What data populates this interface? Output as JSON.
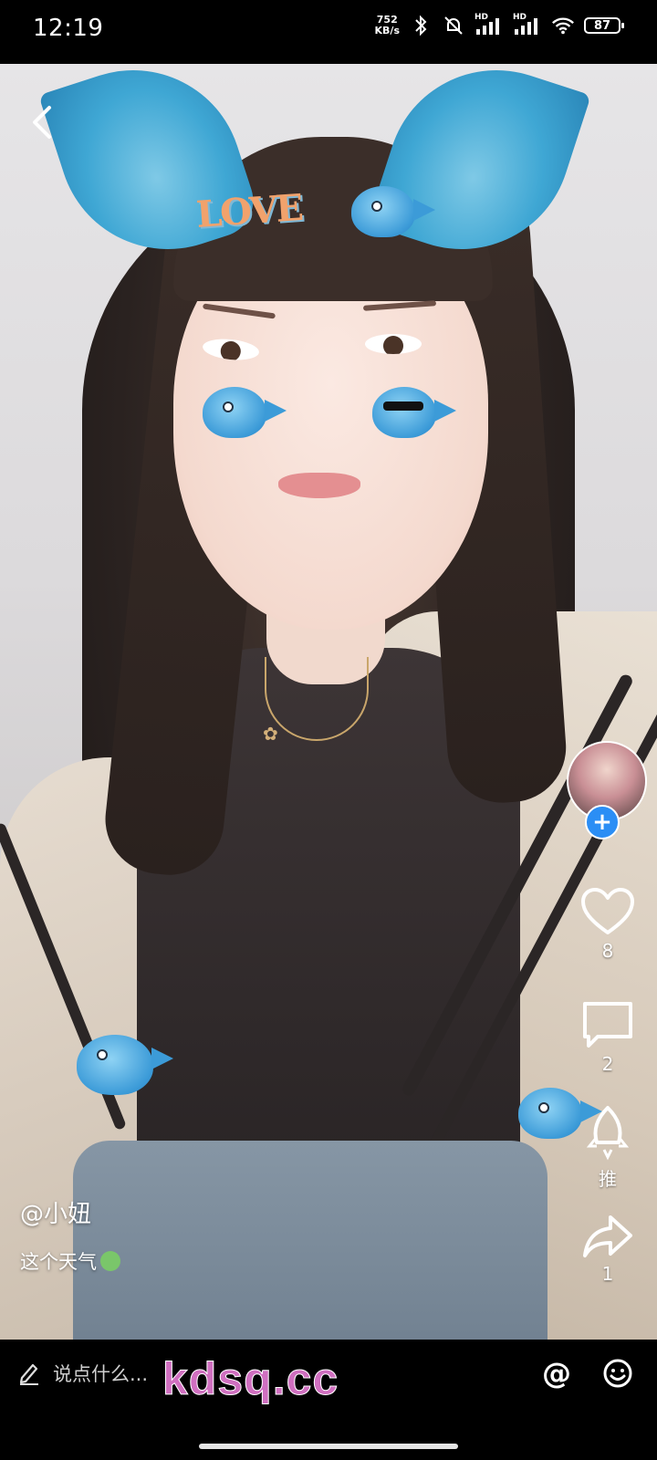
{
  "status_bar": {
    "time": "12:19",
    "speed_value": "752",
    "speed_unit": "KB/s",
    "hd1": "HD",
    "hd2": "HD",
    "battery": "87"
  },
  "actions": {
    "like_count": "8",
    "comment_count": "2",
    "recommend_label": "推",
    "share_count": "1"
  },
  "caption": {
    "author": "@小妞",
    "description": "这个天气"
  },
  "sticker_text": "LOVE",
  "comment_bar": {
    "placeholder": "说点什么...",
    "at_symbol": "@",
    "watermark": "kdsq.cc"
  },
  "colors": {
    "follow_button": "#2b8ef5",
    "watermark": "#d06fc0"
  }
}
